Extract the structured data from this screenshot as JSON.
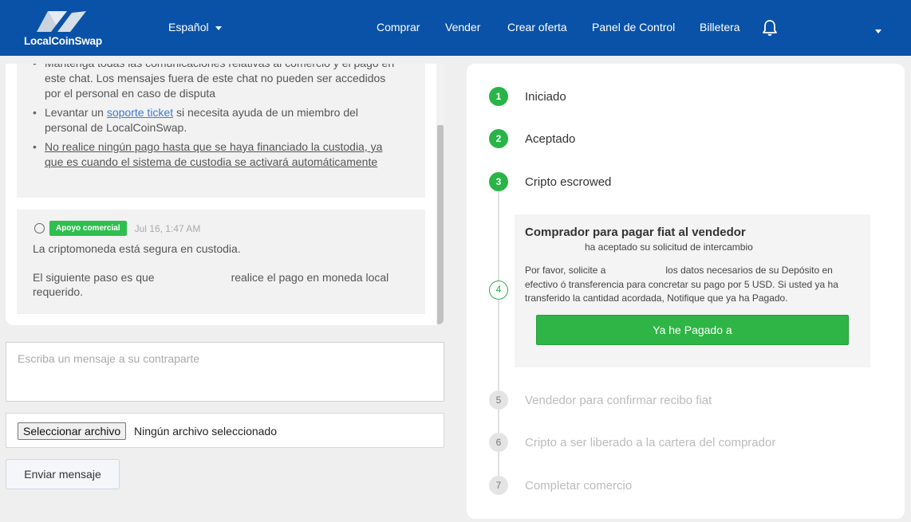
{
  "app": {
    "logo_text": "LocalCoinSwap"
  },
  "nav": {
    "language": "Español",
    "links": [
      "Comprar",
      "Vender",
      "Crear oferta",
      "Panel de Control",
      "Billetera"
    ]
  },
  "chat": {
    "rules": {
      "item1": "Mantenga todas las comunicaciones relativas al comercio y el pago en este chat. Los mensajes fuera de este chat no pueden ser accedidos por el personal en caso de disputa",
      "item2_pre": "Levantar un ",
      "item2_link": "soporte ticket",
      "item2_post": " si necesita ayuda de un miembro del personal de LocalCoinSwap.",
      "item3": "No realice ningún pago hasta que se haya financiado la custodia, ya que es cuando el sistema de custodia se activará automáticamente"
    },
    "message": {
      "badge": "Apoyo comercial",
      "time": "Jul 16, 1:47 AM",
      "line1": "La criptomoneda está segura en custodia.",
      "line2_pre": "El siguiente paso es que",
      "line2_post": "realice el pago en moneda local requerido."
    },
    "input_placeholder": "Escriba un mensaje a su contraparte",
    "file_button": "Seleccionar archivo",
    "file_status": "Ningún archivo seleccionado",
    "send_button": "Enviar mensaje"
  },
  "steps": {
    "items": [
      {
        "num": "1",
        "label": "Iniciado"
      },
      {
        "num": "2",
        "label": "Aceptado"
      },
      {
        "num": "3",
        "label": "Cripto escrowed"
      },
      {
        "num": "4",
        "label": "Comprador para pagar fiat al vendedor"
      },
      {
        "num": "5",
        "label": "Vendedor para confirmar recibo fiat"
      },
      {
        "num": "6",
        "label": "Cripto a ser liberado a la cartera del comprador"
      },
      {
        "num": "7",
        "label": "Completar comercio"
      }
    ],
    "active": {
      "subtitle": "ha aceptado su solicitud de intercambio",
      "desc_pre": "Por favor, solicite a",
      "desc_post": "los datos necesarios de su Depósito en efectivo ó transferencia para concretar su pago por 5 USD. Si usted ya ha transferido la cantidad acordada, Notifique que ya ha Pagado.",
      "button": "Ya he Pagado a"
    }
  },
  "colors": {
    "nav_bg": "#0a52a8",
    "success": "#2fb545",
    "badge": "#2ebf4f",
    "link": "#3b7cd8"
  }
}
